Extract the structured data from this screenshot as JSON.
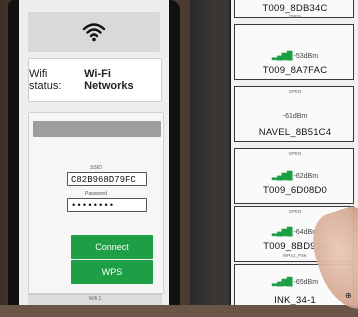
{
  "left_screen": {
    "status_label": "Wifi status:",
    "status_value": "Wi-Fi Networks",
    "ssid_label": "SSID",
    "ssid_value": "C82B968D79FC",
    "password_label": "Password",
    "password_value": "••••••••",
    "connect_label": "Connect",
    "wps_label": "WPS",
    "bottom_text": "Wifi 1"
  },
  "right_screen": {
    "networks": [
      {
        "ssid": "T009_8DB34C",
        "signal": "",
        "security": "OPEN"
      },
      {
        "ssid": "T009_8A7FAC",
        "signal": "-53dBm",
        "security": "OPEN"
      },
      {
        "ssid": "NAVEL_8B51C4",
        "signal": "-61dBm",
        "security": "OPEN"
      },
      {
        "ssid": "T009_6D08D0",
        "signal": "-62dBm",
        "security": "OPEN"
      },
      {
        "ssid": "T009_8BD990",
        "signal": "-64dBm",
        "security": "WPA2_PSK"
      },
      {
        "ssid": "INK_34-1",
        "signal": "-65dBm",
        "security": ""
      }
    ]
  },
  "colors": {
    "accent_green": "#1e9e45",
    "signal_green": "#1e9e45"
  }
}
